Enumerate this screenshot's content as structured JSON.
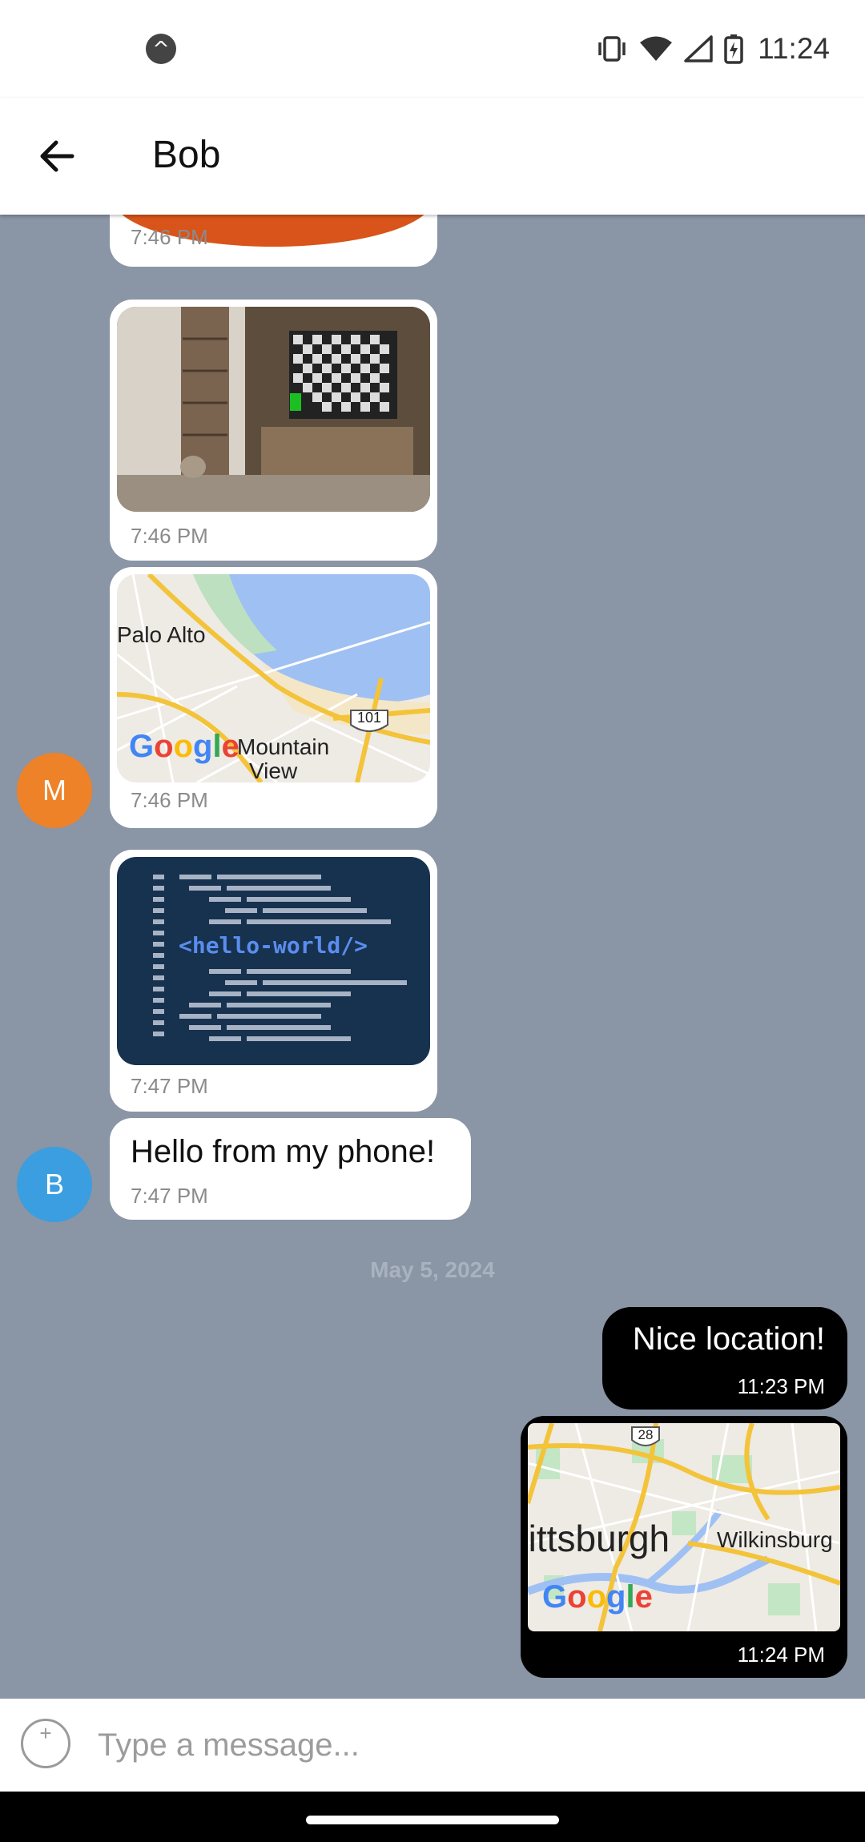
{
  "status_bar": {
    "time": "11:24",
    "icons": [
      "app-logo-icon",
      "vibrate-icon",
      "wifi-icon",
      "signal-icon",
      "battery-charging-icon"
    ]
  },
  "header": {
    "back_icon": "arrow-left-icon",
    "title": "Bob"
  },
  "avatars": {
    "m": {
      "initial": "M",
      "color": "#ee8228"
    },
    "b": {
      "initial": "B",
      "color": "#3a9ee0"
    }
  },
  "messages": [
    {
      "sender": "M",
      "type": "image",
      "content": "photo of plant pot (partially scrolled)",
      "time": "7:46 PM"
    },
    {
      "sender": "M",
      "type": "image",
      "content": "room with TV showing checkerboard",
      "time": "7:46 PM"
    },
    {
      "sender": "M",
      "type": "map",
      "map_labels": [
        "Palo Alto",
        "Mountain View",
        "101",
        "Google"
      ],
      "time": "7:46 PM"
    },
    {
      "sender": "M",
      "type": "image",
      "image_text": "<hello-world/>",
      "time": "7:47 PM"
    },
    {
      "sender": "B",
      "type": "text",
      "text": "Hello from my phone!",
      "time": "7:47 PM"
    }
  ],
  "date_separator": "May 5, 2024",
  "outgoing": [
    {
      "type": "text",
      "text": "Nice location!",
      "time": "11:23 PM"
    },
    {
      "type": "map",
      "map_labels": [
        "Pittsburgh",
        "Wilkinsburg",
        "28",
        "Google"
      ],
      "time": "11:24 PM"
    }
  ],
  "composer": {
    "placeholder": "Type a message...",
    "attach_icon": "plus-circle-icon"
  },
  "colors": {
    "chat_background": "#8a95a5",
    "outgoing_bubble": "#000000",
    "incoming_bubble": "#ffffff"
  }
}
